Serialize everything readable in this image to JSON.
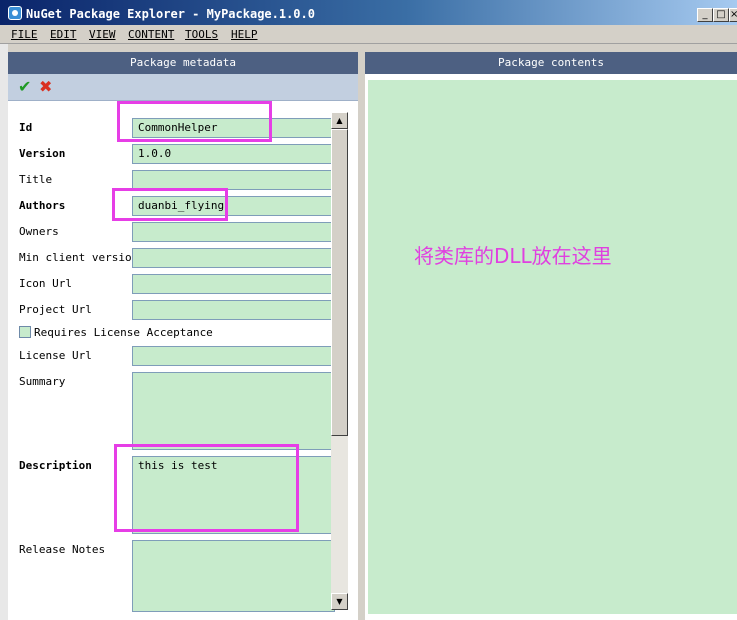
{
  "window": {
    "title": "NuGet Package Explorer - MyPackage.1.0.0",
    "controls": {
      "minimize": "_",
      "maximize": "□",
      "close": "×"
    }
  },
  "menu": {
    "items": [
      {
        "label": "FILE"
      },
      {
        "label": "EDIT"
      },
      {
        "label": "VIEW"
      },
      {
        "label": "CONTENT"
      },
      {
        "label": "TOOLS"
      },
      {
        "label": "HELP"
      }
    ]
  },
  "metadata_panel": {
    "header": "Package metadata",
    "toolbar": {
      "save_icon": "check-icon",
      "cancel_icon": "x-icon"
    },
    "fields": {
      "id": {
        "label": "Id",
        "value": "CommonHelper"
      },
      "version": {
        "label": "Version",
        "value": "1.0.0"
      },
      "title": {
        "label": "Title",
        "value": ""
      },
      "authors": {
        "label": "Authors",
        "value": "duanbi_flying"
      },
      "owners": {
        "label": "Owners",
        "value": ""
      },
      "min_client_version": {
        "label": "Min client version",
        "value": ""
      },
      "icon_url": {
        "label": "Icon Url",
        "value": ""
      },
      "project_url": {
        "label": "Project Url",
        "value": ""
      },
      "requires_license": {
        "label": "Requires License Acceptance",
        "checked": false
      },
      "license_url": {
        "label": "License Url",
        "value": ""
      },
      "summary": {
        "label": "Summary",
        "value": ""
      },
      "description": {
        "label": "Description",
        "value": "this is test"
      },
      "release_notes": {
        "label": "Release Notes",
        "value": ""
      }
    }
  },
  "contents_panel": {
    "header": "Package contents",
    "annotation": "将类库的DLL放在这里"
  },
  "colors": {
    "field_bg": "#c7ebcc",
    "panel_header": "#4d6082",
    "annotation": "#e040e0"
  }
}
